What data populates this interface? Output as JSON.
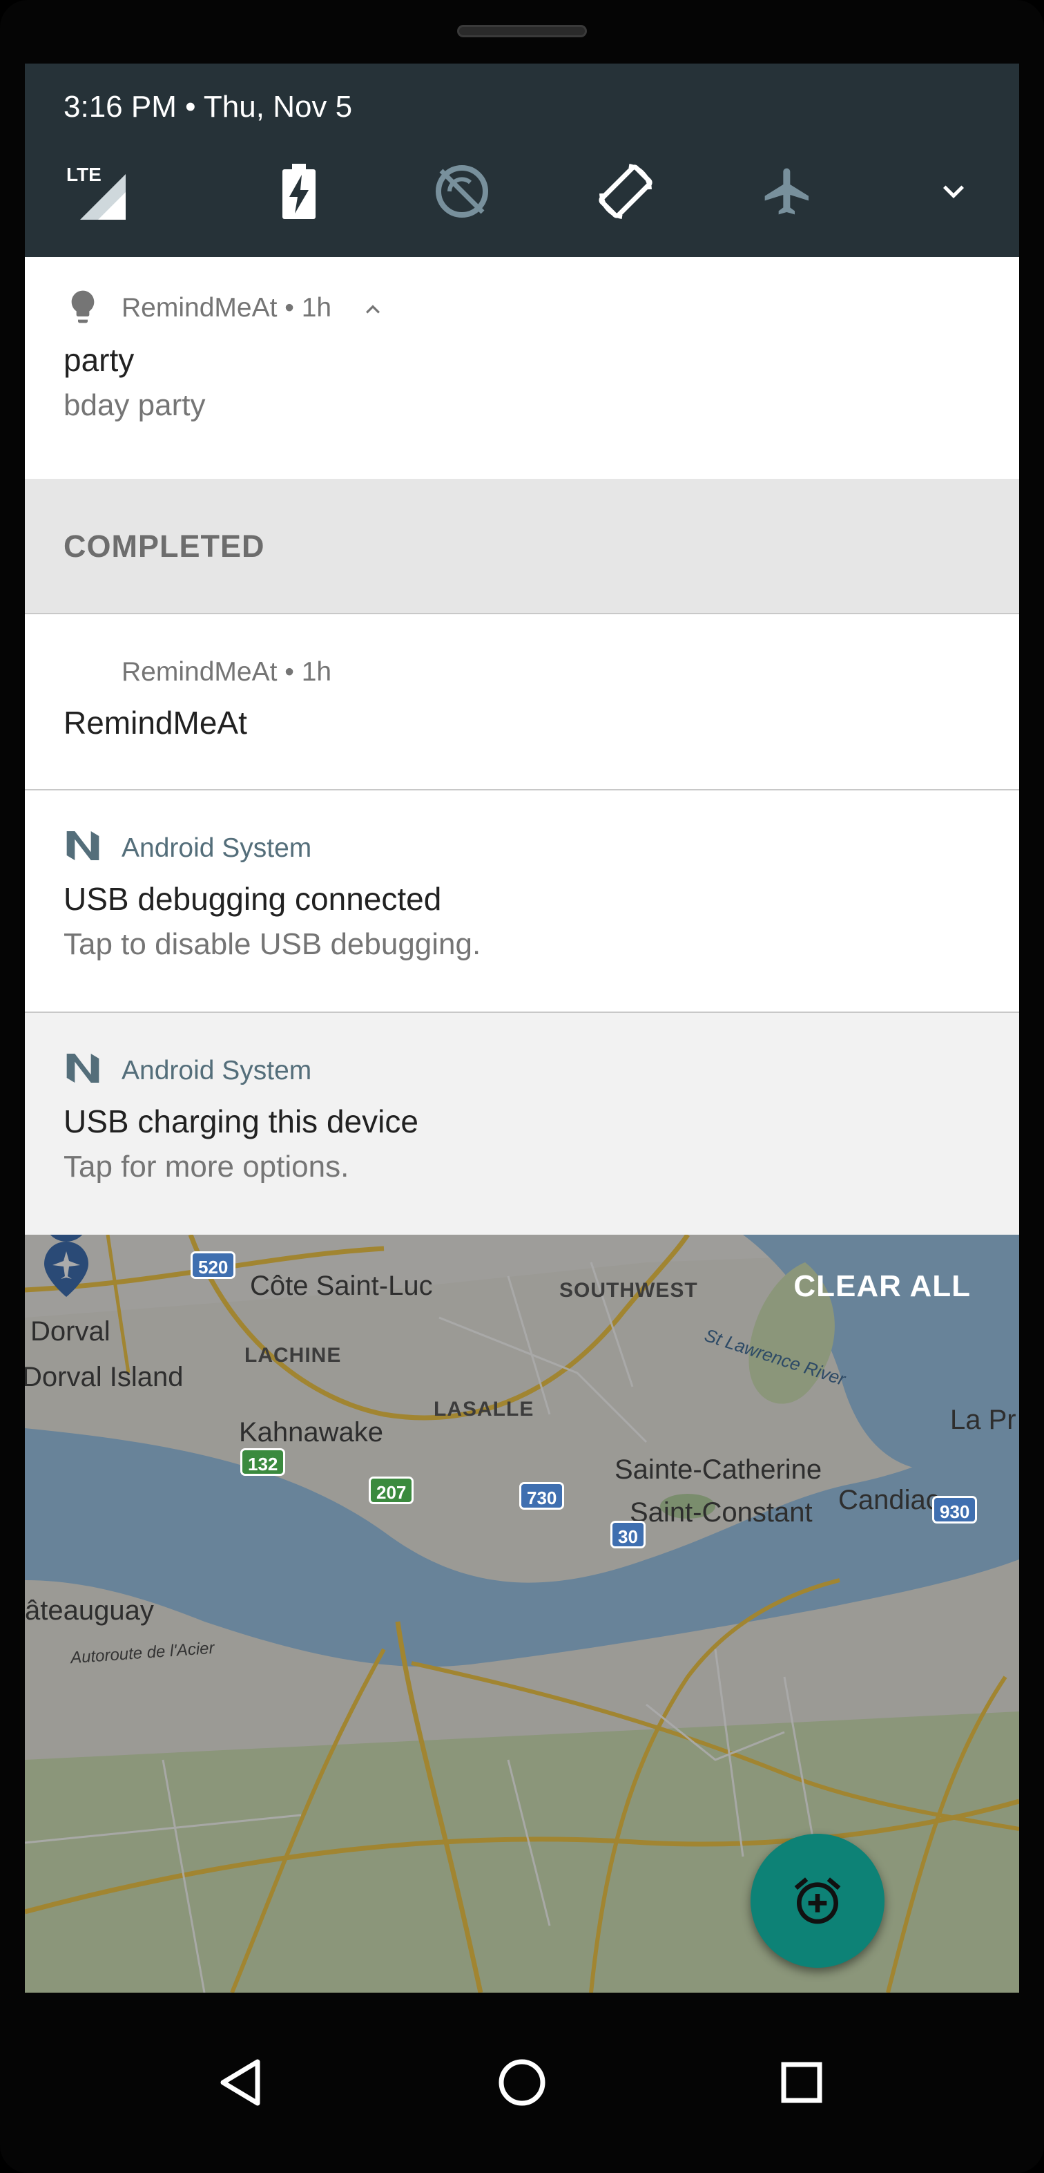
{
  "status": {
    "time_date": "3:16 PM • Thu, Nov 5"
  },
  "quick_settings": {
    "icons": [
      "lte-signal-icon",
      "battery-charging-icon",
      "data-saver-icon",
      "auto-rotate-icon",
      "airplane-mode-icon",
      "expand-icon"
    ],
    "lte_label": "LTE"
  },
  "notifications": {
    "n1": {
      "app": "RemindMeAt",
      "header_suffix": " • 1h",
      "title": "party",
      "text": "bday party"
    },
    "section_label": "COMPLETED",
    "n2": {
      "app": "RemindMeAt",
      "header_suffix": " • 1h",
      "title": "RemindMeAt"
    },
    "n3": {
      "app": "Android System",
      "title": "USB debugging connected",
      "text": "Tap to disable USB debugging."
    },
    "n4": {
      "app": "Android System",
      "title": "USB charging this device",
      "text": "Tap for more options."
    }
  },
  "clear_all": "CLEAR ALL",
  "map": {
    "labels": {
      "cote": "Côte Saint-Luc",
      "southwest": "SOUTHWEST",
      "dorval": "Dorval",
      "lachine": "LACHINE",
      "dorval_island": "Dorval Island",
      "lasalle": "LASALLE",
      "river": "St Lawrence River",
      "kahnawake": "Kahnawake",
      "la_pr": "La Pr",
      "sainte_catherine": "Sainte-Catherine",
      "candiac": "Candiac",
      "saint_constant": "Saint-Constant",
      "chateauguay": "âteauguay",
      "autoroute": "Autoroute de l'Acier"
    },
    "shields": {
      "s520": "520",
      "s132": "132",
      "s207": "207",
      "s730": "730",
      "s30": "30",
      "s930": "930"
    }
  },
  "colors": {
    "quick_settings_bg": "#263238",
    "fab": "#0d8276",
    "system_app": "#546e7a"
  }
}
